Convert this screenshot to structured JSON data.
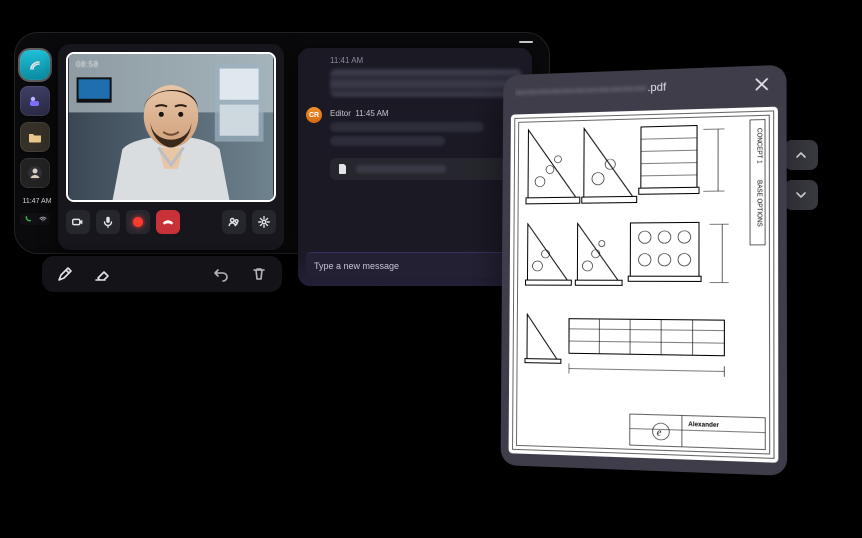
{
  "sidebar": {
    "clock": "11:47 AM",
    "apps": [
      {
        "name": "immersive-app"
      },
      {
        "name": "teams-app"
      },
      {
        "name": "files-app"
      },
      {
        "name": "people-app"
      }
    ]
  },
  "call": {
    "header_label": "08:58",
    "controls": {
      "camera": "camera",
      "mic": "mic",
      "record": "record",
      "hangup": "hang up",
      "participants": "participants",
      "settings": "settings"
    }
  },
  "annotate": {
    "pen": "pen",
    "eraser": "eraser",
    "undo": "undo",
    "delete": "delete"
  },
  "chat": {
    "msg1_ts": "11:41 AM",
    "msg2_sender": "Editor",
    "msg2_ts": "11:45 AM",
    "avatar_initials": "CR",
    "input_placeholder": "Type a new message"
  },
  "pdf": {
    "title_suffix": ".pdf",
    "title_blurred": "———————————",
    "page_labels": {
      "concept": "CONCEPT 1",
      "base_options": "BASE OPTIONS",
      "brand": "Alexander"
    }
  }
}
